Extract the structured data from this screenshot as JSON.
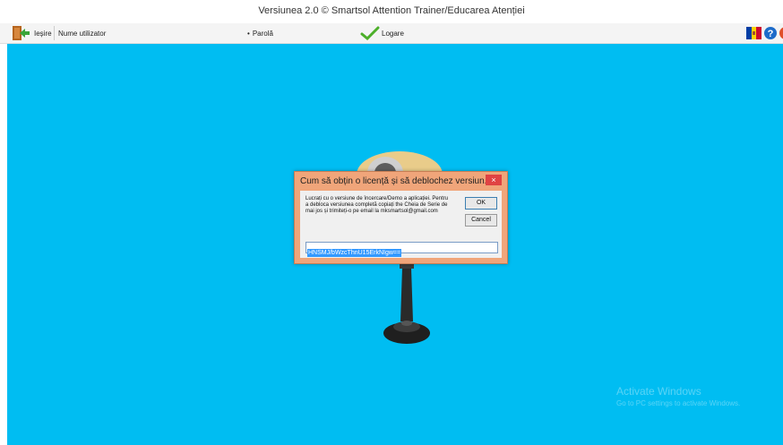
{
  "window": {
    "title": "Versiunea 2.0 © Smartsol Attention Trainer/Educarea Atenției"
  },
  "toolbar": {
    "exit_label": "Ieșire",
    "username_label": "Nume utilizator",
    "password_label": "Parolă",
    "login_label": "Logare",
    "password_marker": "•"
  },
  "dialog": {
    "title": "Cum să obțin o licență și să deblochez versiun...",
    "close_label": "×",
    "message": "Lucrați cu o versiune de încercare/Demo a aplicației. Pentru a debloca versiunea completă copiați the Cheia de Serie de mai jos și trimiteți-o pe email la mksmartsol@gmail.com",
    "ok_label": "OK",
    "cancel_label": "Cancel",
    "serial_value": "HNSMJ/bWzcThnU15ErkNIgw=="
  },
  "watermark": {
    "line1": "Activate Windows",
    "line2": "Go to PC settings to activate Windows."
  },
  "colors": {
    "canvas": "#00bdf2",
    "dialog_frame": "#f0a57a",
    "close_button": "#e04343",
    "selection": "#3399ff"
  },
  "icons": [
    "exit-door-icon",
    "checkmark-icon",
    "moldova-flag-icon",
    "help-icon"
  ]
}
